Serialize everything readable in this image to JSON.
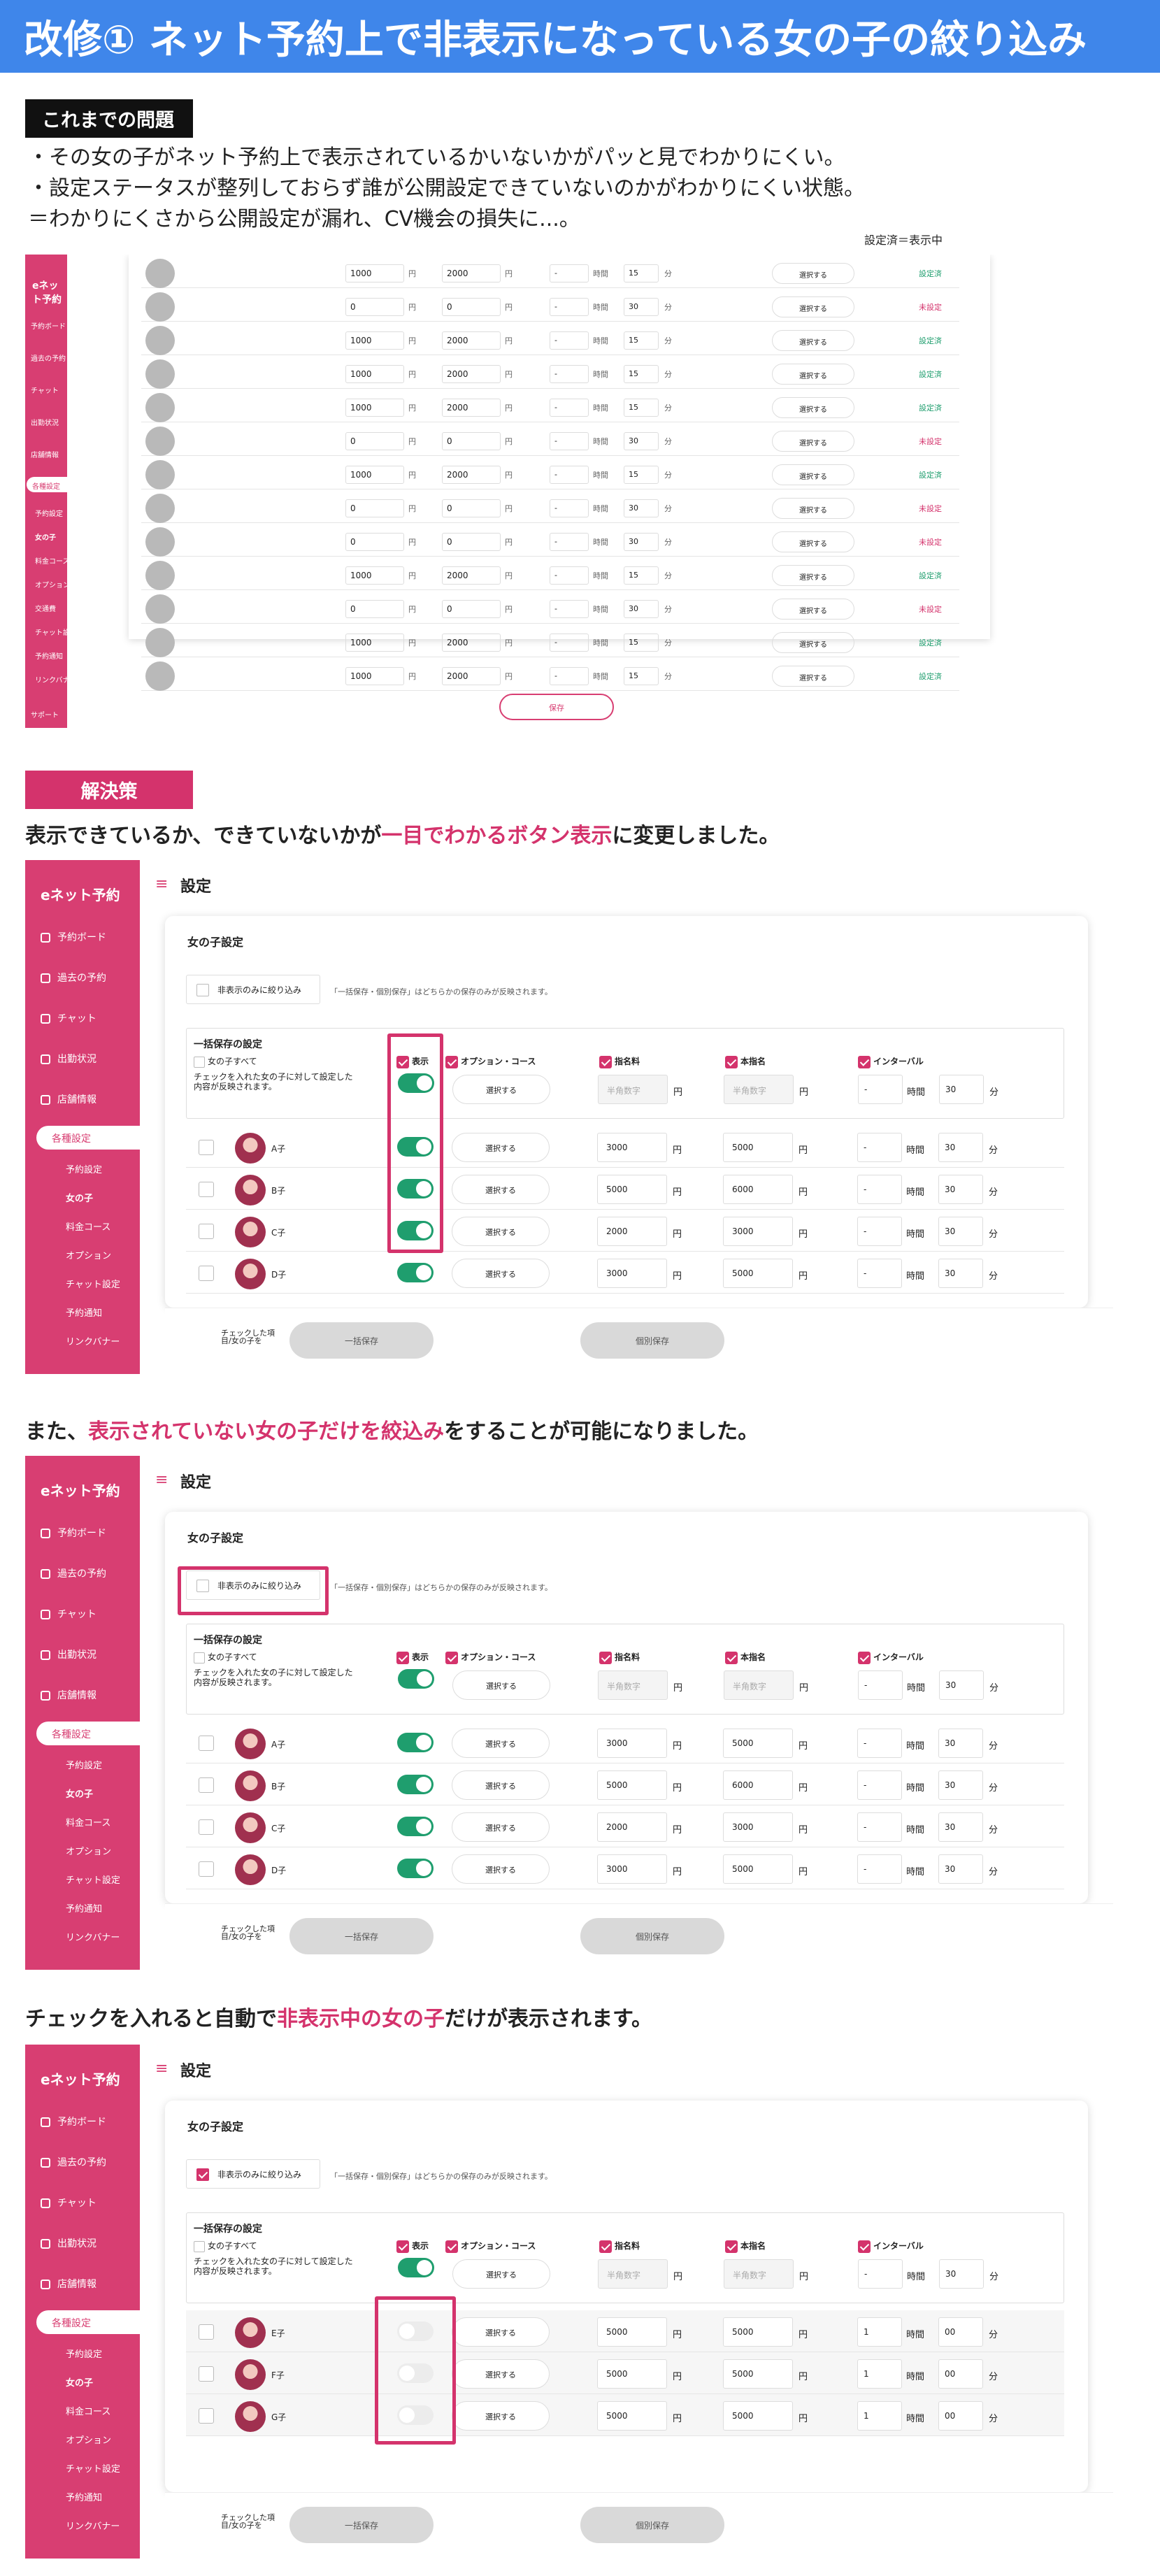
{
  "title": "改修① ネット予約上で非表示になっている女の子の絞り込み",
  "problem_label": "これまでの問題",
  "problem_lines": [
    "・その女の子がネット予約上で表示されているかいないかがパッと見でわかりにくい。",
    "・設定ステータスが整列しておらず誰が公開設定できていないのかがわかりにくい状態。",
    "＝わかりにくさから公開設定が漏れ、CV機会の損失に...。"
  ],
  "status_note": "設定済＝表示中",
  "old": {
    "logo": "eネット予約",
    "menu": [
      "予約ボード",
      "過去の予約",
      "チャット",
      "出勤状況",
      "店舗情報"
    ],
    "active": "各種設定",
    "submenu": [
      "予約設定",
      "女の子",
      "料金コース",
      "オプション",
      "交通費",
      "チャット設定",
      "予約通知",
      "リンクバナー"
    ],
    "support": "サポート",
    "yen": "円",
    "dash": "-",
    "hour": "時間",
    "minute": "分",
    "select_btn": "選択する",
    "save": "保存",
    "rows": [
      {
        "a": "1000",
        "b": "2000",
        "m": "15",
        "s": "設定済"
      },
      {
        "a": "0",
        "b": "0",
        "m": "30",
        "s": "未設定"
      },
      {
        "a": "1000",
        "b": "2000",
        "m": "15",
        "s": "設定済"
      },
      {
        "a": "1000",
        "b": "2000",
        "m": "15",
        "s": "設定済"
      },
      {
        "a": "1000",
        "b": "2000",
        "m": "15",
        "s": "設定済"
      },
      {
        "a": "0",
        "b": "0",
        "m": "30",
        "s": "未設定"
      },
      {
        "a": "1000",
        "b": "2000",
        "m": "15",
        "s": "設定済"
      },
      {
        "a": "0",
        "b": "0",
        "m": "30",
        "s": "未設定"
      },
      {
        "a": "0",
        "b": "0",
        "m": "30",
        "s": "未設定"
      },
      {
        "a": "1000",
        "b": "2000",
        "m": "15",
        "s": "設定済"
      },
      {
        "a": "0",
        "b": "0",
        "m": "30",
        "s": "未設定"
      },
      {
        "a": "1000",
        "b": "2000",
        "m": "15",
        "s": "設定済"
      },
      {
        "a": "1000",
        "b": "2000",
        "m": "15",
        "s": "設定済"
      }
    ]
  },
  "solution_label": "解決策",
  "sections": [
    {
      "pre": "表示できているか、できていないかが",
      "hl": "一目でわかるボタン表示",
      "post": "に変更しました。"
    },
    {
      "pre": "また、",
      "hl": "表示されていない女の子だけを絞込み",
      "post": "をすることが可能になりました。"
    },
    {
      "pre": "チェックを入れると自動で",
      "hl": "非表示中の女の子",
      "post": "だけが表示されます。"
    }
  ],
  "ui": {
    "logo": "eネット予約",
    "page_title": "設定",
    "menu": [
      "予約ボード",
      "過去の予約",
      "チャット",
      "出勤状況",
      "店舗情報"
    ],
    "active": "各種設定",
    "submenu": [
      "予約設定",
      "女の子",
      "料金コース",
      "オプション",
      "チャット設定",
      "予約通知",
      "リンクバナー"
    ],
    "card_title": "女の子設定",
    "filter_label": "非表示のみに絞り込み",
    "filter_note": "「一括保存・個別保存」はどちらかの保存のみが反映されます。",
    "bulk_title": "一括保存の設定",
    "all_girls": "女の子すべて",
    "bulk_note": "チェックを入れた女の子に対して設定した内容が反映されます。",
    "col_display": "表示",
    "col_option": "オプション・コース",
    "col_fee": "指名料",
    "col_honshimei": "本指名",
    "col_interval": "インターバル",
    "select_btn": "選択する",
    "placeholder": "半角数字",
    "yen": "円",
    "hour": "時間",
    "minute": "分",
    "dash": "-",
    "thirty": "30",
    "footer_note": "チェックした項目/女の子を",
    "bulk_save": "一括保存",
    "indiv_save": "個別保存"
  },
  "girls_shown": [
    {
      "name": "A子",
      "fee": "3000",
      "hon": "5000"
    },
    {
      "name": "B子",
      "fee": "5000",
      "hon": "6000"
    },
    {
      "name": "C子",
      "fee": "2000",
      "hon": "3000"
    },
    {
      "name": "D子",
      "fee": "3000",
      "hon": "5000"
    }
  ],
  "girls_hidden": [
    {
      "name": "E子",
      "fee": "5000",
      "hon": "5000",
      "h": "1",
      "m": "00"
    },
    {
      "name": "F子",
      "fee": "5000",
      "hon": "5000",
      "h": "1",
      "m": "00"
    },
    {
      "name": "G子",
      "fee": "5000",
      "hon": "5000",
      "h": "1",
      "m": "00"
    }
  ]
}
